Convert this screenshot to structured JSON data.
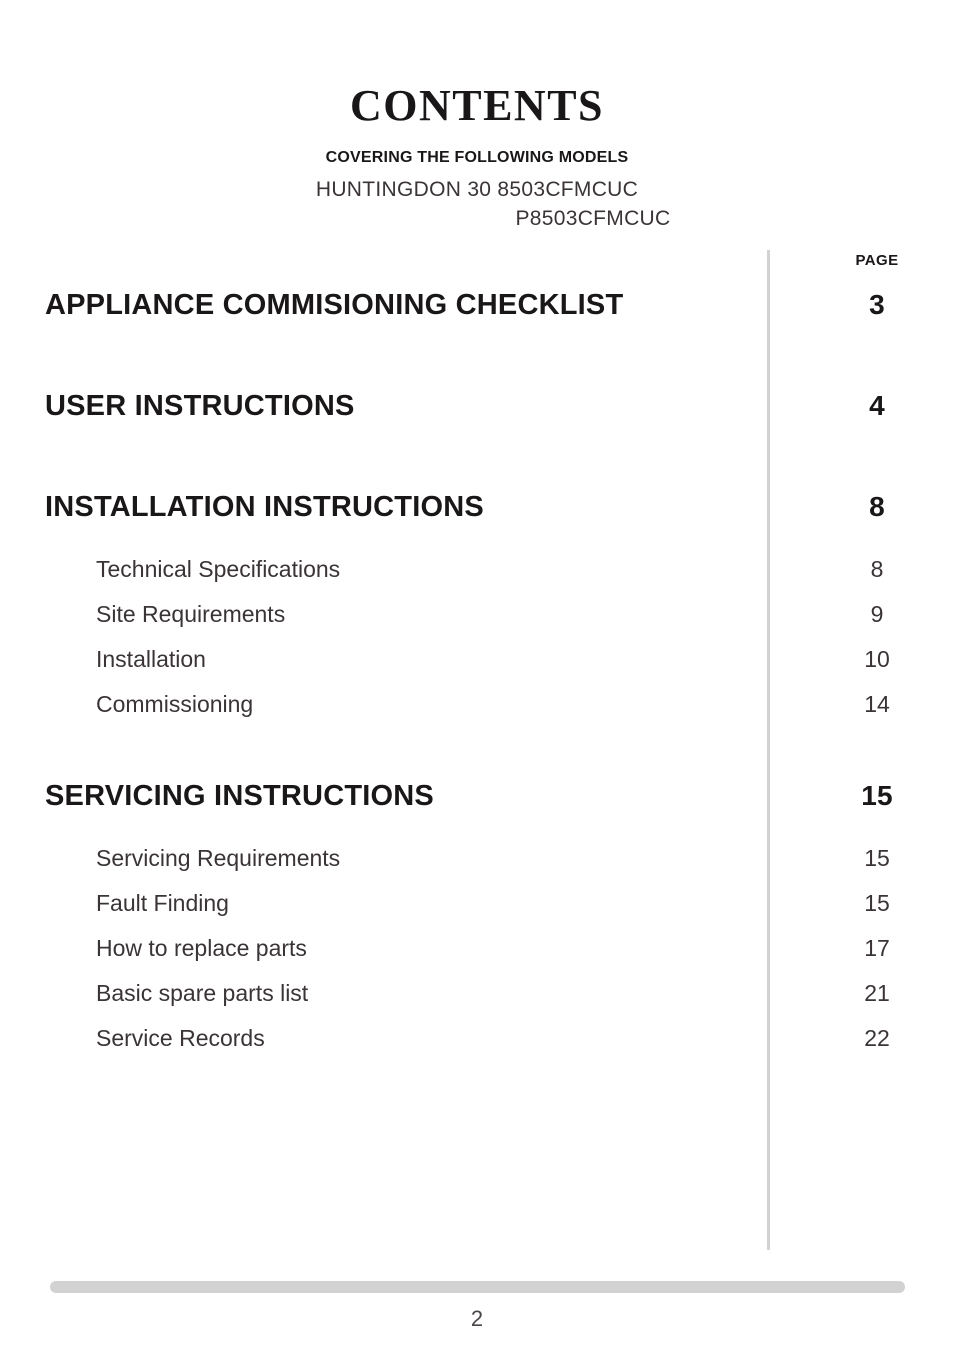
{
  "header": {
    "title": "CONTENTS",
    "covering_label": "COVERING THE FOLLOWING MODELS",
    "models": [
      "HUNTINGDON 30  8503CFMCUC",
      "P8503CFMCUC"
    ]
  },
  "toc": {
    "page_column_header": "PAGE",
    "sections": [
      {
        "label": "APPLIANCE COMMISIONING CHECKLIST",
        "page": "3",
        "items": []
      },
      {
        "label": "USER INSTRUCTIONS",
        "page": "4",
        "items": []
      },
      {
        "label": "INSTALLATION INSTRUCTIONS",
        "page": "8",
        "items": [
          {
            "label": "Technical Specifications",
            "page": "8"
          },
          {
            "label": "Site Requirements",
            "page": "9"
          },
          {
            "label": "Installation",
            "page": "10"
          },
          {
            "label": "Commissioning",
            "page": "14"
          }
        ]
      },
      {
        "label": "SERVICING INSTRUCTIONS",
        "page": "15",
        "items": [
          {
            "label": "Servicing Requirements",
            "page": "15"
          },
          {
            "label": "Fault Finding",
            "page": "15"
          },
          {
            "label": "How to replace parts",
            "page": "17"
          },
          {
            "label": "Basic spare parts list",
            "page": "21"
          },
          {
            "label": "Service Records",
            "page": "22"
          }
        ]
      }
    ]
  },
  "footer": {
    "page_number": "2"
  },
  "colors": {
    "text": "#231f20",
    "heading": "#1a1718",
    "subtext": "#3a3436",
    "divider": "#d2d2d4",
    "footer_bar": "#d2d2d2",
    "background": "#ffffff"
  }
}
